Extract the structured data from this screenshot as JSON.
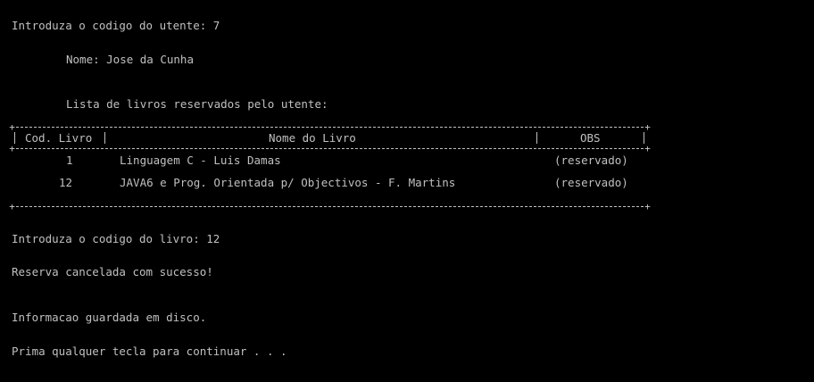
{
  "console": {
    "prompt_utente": "Introduza o codigo do utente: 7",
    "nome_line": "Nome: Jose da Cunha",
    "lista_title": "Lista de livros reservados pelo utente:",
    "table": {
      "headers": {
        "cod": "Cod. Livro",
        "nome": "Nome do Livro",
        "obs": "OBS"
      },
      "rows": [
        {
          "cod": "1",
          "nome": "Linguagem C - Luis Damas",
          "obs": "(reservado)"
        },
        {
          "cod": "12",
          "nome": "JAVA6 e Prog. Orientada p/ Objectivos - F. Martins",
          "obs": "(reservado)"
        }
      ]
    },
    "prompt_livro": "Introduza o codigo do livro: 12",
    "reserva_msg": "Reserva cancelada com sucesso!",
    "disco_msg": "Informacao guardada em disco.",
    "continuar_msg": "Prima qualquer tecla para continuar . . ."
  },
  "colors": {
    "background": "#000000",
    "text": "#c0c0c0"
  }
}
